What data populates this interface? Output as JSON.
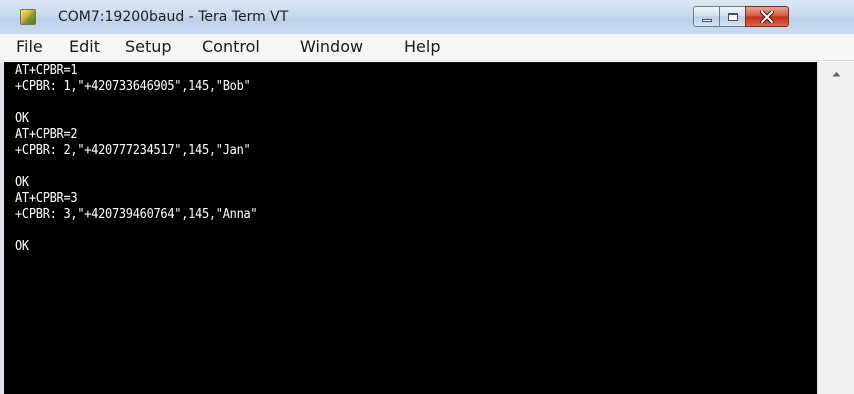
{
  "window": {
    "title": "COM7:19200baud - Tera Term VT",
    "app_icon": "tera-term-icon",
    "controls": [
      "minimize-icon",
      "maximize-icon",
      "close-icon"
    ],
    "close_color": "#c7381f"
  },
  "menu": {
    "items": [
      "File",
      "Edit",
      "Setup",
      "Control",
      "Window",
      "Help"
    ]
  },
  "terminal": {
    "background": "#000000",
    "foreground": "#ffffff",
    "lines": [
      "AT+CPBR=1",
      "+CPBR: 1,\"+420733646905\",145,\"Bob\"",
      "",
      "OK",
      "AT+CPBR=2",
      "+CPBR: 2,\"+420777234517\",145,\"Jan\"",
      "",
      "OK",
      "AT+CPBR=3",
      "+CPBR: 3,\"+420739460764\",145,\"Anna\"",
      "",
      "OK"
    ]
  },
  "scrollbar": {
    "up_arrow": "scroll-up-arrow-icon"
  }
}
